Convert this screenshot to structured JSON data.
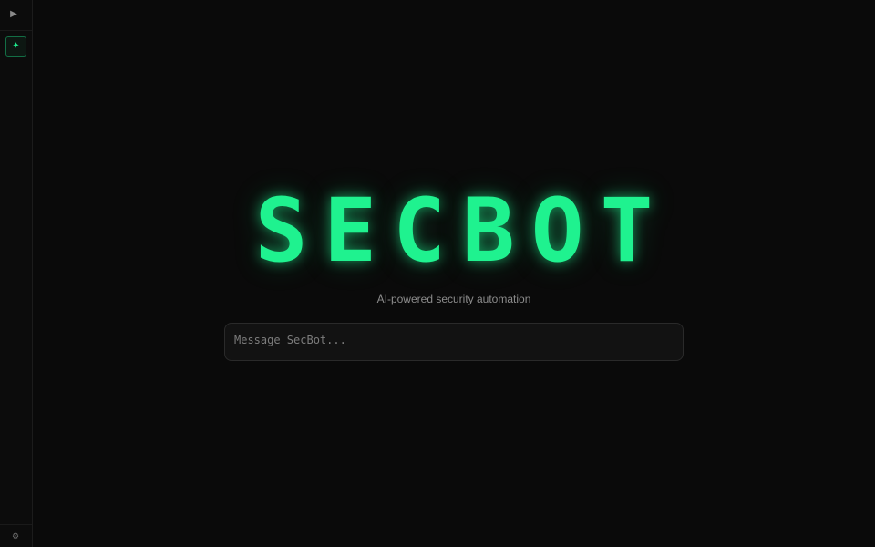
{
  "app": {
    "title": "SECBOT",
    "subtitle": "AI-powered security automation",
    "accent_color": "#1ff28f",
    "background_color": "#0a0a0a"
  },
  "sidebar": {
    "toggle_icon": "play-icon",
    "toggle_glyph": "▶",
    "new_chat_icon": "sparkle-icon",
    "new_chat_glyph": "✦",
    "settings_icon": "settings-icon",
    "settings_glyph": "⚙"
  },
  "composer": {
    "placeholder": "Message SecBot...",
    "value": ""
  }
}
